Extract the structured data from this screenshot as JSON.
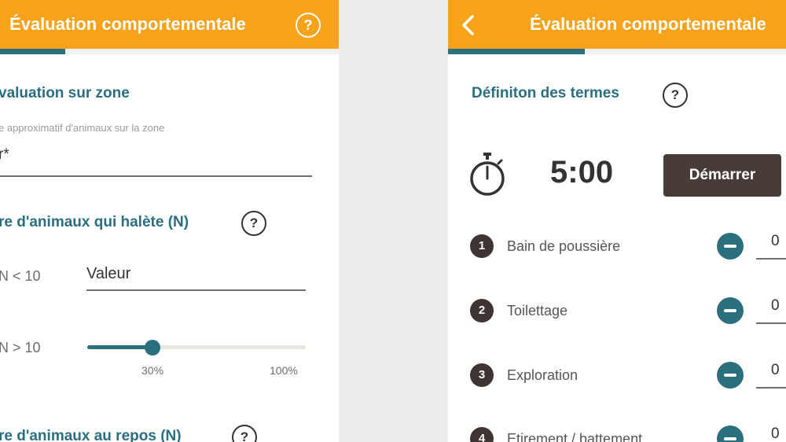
{
  "left_screen": {
    "app_title": "Évaluation comportementale",
    "section1_title": "valuation sur zone",
    "estimate_hint": "e approximatif d'animaux sur la zone",
    "estimate_field_value": "r*",
    "section2_title": "re d'animaux qui halète (N)",
    "option_lt10_label": "N < 10",
    "valeur_placeholder": "Valeur",
    "option_gt10_label": "N > 10",
    "slider": {
      "value_percent": 30,
      "value_label": "30%",
      "max_label": "100%"
    },
    "section3_title": "re d'animaux au repos (N)"
  },
  "right_screen": {
    "back_icon": "chevron-left-icon",
    "app_title": "Évaluation comportementale",
    "definitions_title": "Définiton des termes",
    "timer_icon": "stopwatch-icon",
    "timer_value": "5:00",
    "start_label": "Démarrer",
    "behaviors": [
      {
        "number": "1",
        "label": "Bain de poussière",
        "count": "0"
      },
      {
        "number": "2",
        "label": "Toilettage",
        "count": "0"
      },
      {
        "number": "3",
        "label": "Exploration",
        "count": "0"
      },
      {
        "number": "4",
        "label": "Etirement / battement",
        "count": "0"
      }
    ]
  },
  "colors": {
    "header_orange": "#f7a21b",
    "teal": "#2b6f7e",
    "dark_button": "#473c38"
  }
}
